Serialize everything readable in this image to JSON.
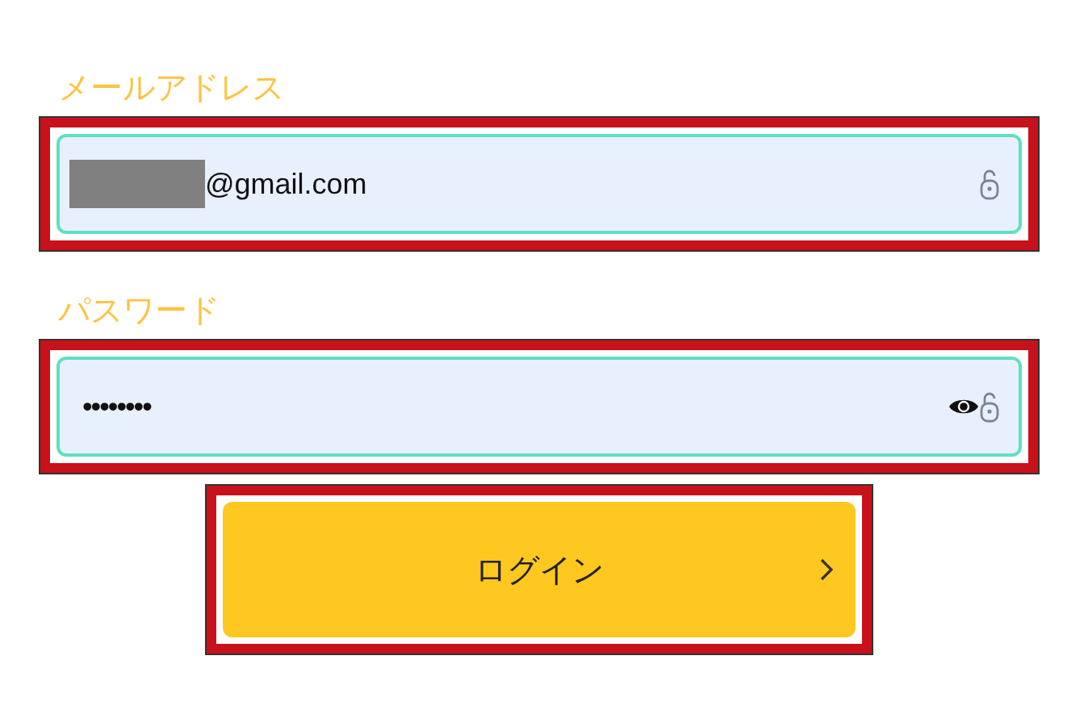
{
  "fields": [
    {
      "kind": "email",
      "label": "メールアドレス",
      "value": "@gmail.com"
    },
    {
      "kind": "password",
      "label": "パスワード",
      "value": "••••••••"
    }
  ],
  "login_button": {
    "label": "ログイン"
  }
}
